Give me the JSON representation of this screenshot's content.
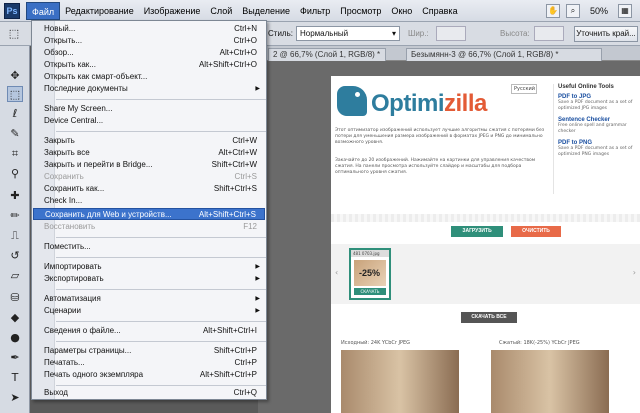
{
  "app": {
    "logo": "Ps"
  },
  "menubar": {
    "items": [
      "Файл",
      "Редактирование",
      "Изображение",
      "Слой",
      "Выделение",
      "Фильтр",
      "Просмотр",
      "Окно",
      "Справка"
    ],
    "zoom": "50%"
  },
  "options": {
    "style_label": "Стиль:",
    "style_value": "Нормальный",
    "width_label": "Шир.:",
    "height_label": "Высота:",
    "refine_button": "Уточнить край..."
  },
  "tabs": [
    "2 @ 66,7% (Слой 1, RGB/8) *",
    "Безымянн-3 @ 66,7% (Слой 1, RGB/8) *"
  ],
  "file_menu": {
    "items": [
      {
        "label": "Новый...",
        "shortcut": "Ctrl+N",
        "disabled": false
      },
      {
        "label": "Открыть...",
        "shortcut": "Ctrl+O",
        "disabled": false
      },
      {
        "label": "Обзор...",
        "shortcut": "Alt+Ctrl+O",
        "disabled": false
      },
      {
        "label": "Открыть как...",
        "shortcut": "Alt+Shift+Ctrl+O",
        "disabled": false
      },
      {
        "label": "Открыть как смарт-объект...",
        "shortcut": "",
        "disabled": false
      },
      {
        "label": "Последние документы",
        "shortcut": "",
        "submenu": true,
        "disabled": false
      },
      {
        "label": "Share My Screen...",
        "shortcut": "",
        "disabled": false
      },
      {
        "label": "Device Central...",
        "shortcut": "",
        "disabled": false
      },
      {
        "label": "Закрыть",
        "shortcut": "Ctrl+W",
        "disabled": false
      },
      {
        "label": "Закрыть все",
        "shortcut": "Alt+Ctrl+W",
        "disabled": false
      },
      {
        "label": "Закрыть и перейти в Bridge...",
        "shortcut": "Shift+Ctrl+W",
        "disabled": false
      },
      {
        "label": "Сохранить",
        "shortcut": "Ctrl+S",
        "disabled": true
      },
      {
        "label": "Сохранить как...",
        "shortcut": "Shift+Ctrl+S",
        "disabled": false
      },
      {
        "label": "Check In...",
        "shortcut": "",
        "disabled": false
      },
      {
        "label": "Сохранить для Web и устройств...",
        "shortcut": "Alt+Shift+Ctrl+S",
        "disabled": false,
        "highlighted": true
      },
      {
        "label": "Восстановить",
        "shortcut": "F12",
        "disabled": true
      },
      {
        "label": "Поместить...",
        "shortcut": "",
        "disabled": false
      },
      {
        "label": "Импортировать",
        "shortcut": "",
        "submenu": true,
        "disabled": false
      },
      {
        "label": "Экспортировать",
        "shortcut": "",
        "submenu": true,
        "disabled": false
      },
      {
        "label": "Автоматизация",
        "shortcut": "",
        "submenu": true,
        "disabled": false
      },
      {
        "label": "Сценарии",
        "shortcut": "",
        "submenu": true,
        "disabled": false
      },
      {
        "label": "Сведения о файле...",
        "shortcut": "Alt+Shift+Ctrl+I",
        "disabled": false
      },
      {
        "label": "Параметры страницы...",
        "shortcut": "Shift+Ctrl+P",
        "disabled": false
      },
      {
        "label": "Печатать...",
        "shortcut": "Ctrl+P",
        "disabled": false
      },
      {
        "label": "Печать одного экземпляра",
        "shortcut": "Alt+Shift+Ctrl+P",
        "disabled": false
      },
      {
        "label": "Выход",
        "shortcut": "Ctrl+Q",
        "disabled": false
      }
    ]
  },
  "webpage": {
    "logo_text": "Optimi",
    "logo_accent": "zilla",
    "lang": "Русский",
    "services_title": "Useful Online Tools",
    "services": [
      {
        "name": "PDF to JPG",
        "desc": "Save a PDF document as a set of optimized JPG images"
      },
      {
        "name": "Sentence Checker",
        "desc": "Free online spell and grammar checker"
      },
      {
        "name": "PDF to PNG",
        "desc": "Save a PDF document as a set of optimized PNG images"
      }
    ],
    "para1": "Этот оптимизатор изображений использует лучшие алгоритмы сжатия с потерями без потери для уменьшения размера изображений в форматах JPEG и PNG до минимально возможного уровня.",
    "para2": "Закачайте до 20 изображений. Нажимайте на картинки для управления качеством сжатия. На панели просмотра используйте слайдер и масштабы для подбора оптимального уровня сжатия.",
    "upload_button": "ЗАГРУЗИТЬ",
    "clear_button": "ОЧИСТИТЬ",
    "thumb_name": "481 0703.jpg",
    "thumb_pct": "-25%",
    "thumb_download": "СКАЧАТЬ",
    "download_all": "СКАЧАТЬ ВСЕ",
    "original_label": "Исходный: 24K YCbCr JPEG",
    "compressed_label": "Сжатый: 18K(-25%) YCbCr JPEG"
  }
}
